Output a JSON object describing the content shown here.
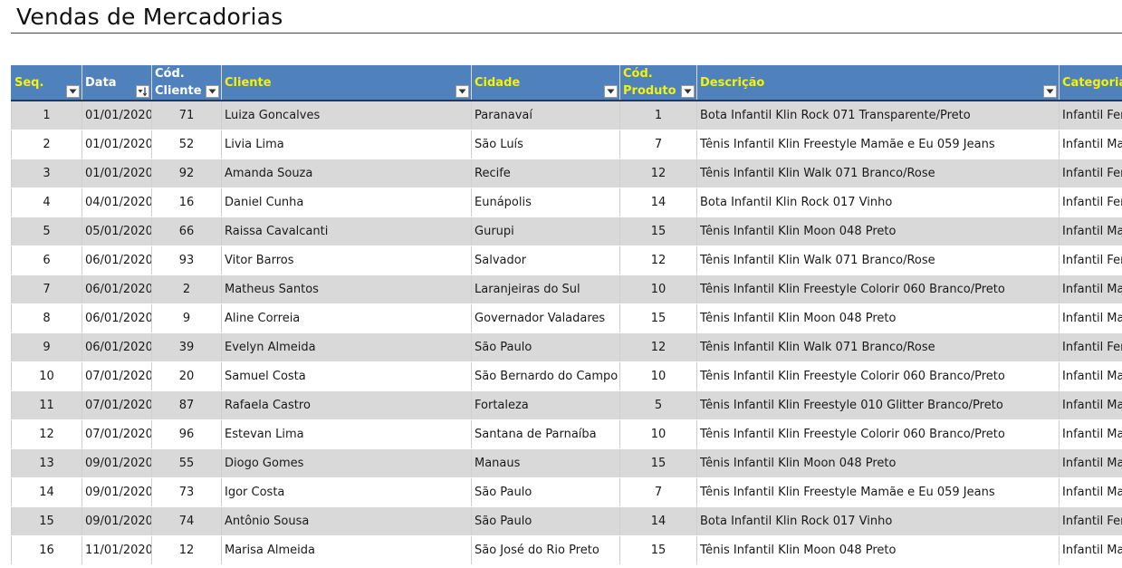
{
  "sheet": {
    "title": "Vendas de Mercadorias"
  },
  "table": {
    "columns": [
      {
        "key": "seq",
        "label": "Seq.",
        "yellow": true,
        "filter": "dropdown-icon"
      },
      {
        "key": "data",
        "label": "Data",
        "yellow": false,
        "filter": "sort-ascending-icon"
      },
      {
        "key": "cod_cliente",
        "label": "Cód. Cliente",
        "yellow": false,
        "filter": "dropdown-icon"
      },
      {
        "key": "cliente",
        "label": "Cliente",
        "yellow": true,
        "filter": "dropdown-icon"
      },
      {
        "key": "cidade",
        "label": "Cidade",
        "yellow": true,
        "filter": "dropdown-icon"
      },
      {
        "key": "cod_produto",
        "label": "Cód. Produto",
        "yellow": true,
        "filter": "dropdown-icon"
      },
      {
        "key": "descricao",
        "label": "Descrição",
        "yellow": true,
        "filter": "dropdown-icon"
      },
      {
        "key": "categoria",
        "label": "Categoria",
        "yellow": true,
        "filter": "dropdown-icon"
      }
    ],
    "rows": [
      [
        "1",
        "01/01/2020",
        "71",
        "Luiza Goncalves",
        "Paranavaí",
        "1",
        "Bota Infantil Klin Rock 071 Transparente/Preto",
        "Infantil Fer"
      ],
      [
        "2",
        "01/01/2020",
        "52",
        "Livia Lima",
        "São Luís",
        "7",
        "Tênis Infantil Klin Freestyle Mamãe e Eu 059 Jeans",
        "Infantil Ma"
      ],
      [
        "3",
        "01/01/2020",
        "92",
        "Amanda Souza",
        "Recife",
        "12",
        "Tênis Infantil Klin Walk 071 Branco/Rose",
        "Infantil Fer"
      ],
      [
        "4",
        "04/01/2020",
        "16",
        "Daniel Cunha",
        "Eunápolis",
        "14",
        "Bota Infantil Klin Rock 017 Vinho",
        "Infantil Fer"
      ],
      [
        "5",
        "05/01/2020",
        "66",
        "Raissa Cavalcanti",
        "Gurupi",
        "15",
        "Tênis Infantil Klin Moon 048 Preto",
        "Infantil Ma"
      ],
      [
        "6",
        "06/01/2020",
        "93",
        "Vitor Barros",
        "Salvador",
        "12",
        "Tênis Infantil Klin Walk 071 Branco/Rose",
        "Infantil Fer"
      ],
      [
        "7",
        "06/01/2020",
        "2",
        "Matheus Santos",
        "Laranjeiras do Sul",
        "10",
        "Tênis Infantil Klin Freestyle Colorir 060 Branco/Preto",
        "Infantil Ma"
      ],
      [
        "8",
        "06/01/2020",
        "9",
        "Aline Correia",
        "Governador Valadares",
        "15",
        "Tênis Infantil Klin Moon 048 Preto",
        "Infantil Ma"
      ],
      [
        "9",
        "06/01/2020",
        "39",
        "Evelyn Almeida",
        "São Paulo",
        "12",
        "Tênis Infantil Klin Walk 071 Branco/Rose",
        "Infantil Fer"
      ],
      [
        "10",
        "07/01/2020",
        "20",
        "Samuel Costa",
        "São Bernardo do Campo",
        "10",
        "Tênis Infantil Klin Freestyle Colorir 060 Branco/Preto",
        "Infantil Ma"
      ],
      [
        "11",
        "07/01/2020",
        "87",
        "Rafaela Castro",
        "Fortaleza",
        "5",
        "Tênis Infantil Klin Freestyle 010 Glitter Branco/Preto",
        "Infantil Ma"
      ],
      [
        "12",
        "07/01/2020",
        "96",
        "Estevan Lima",
        "Santana de Parnaíba",
        "10",
        "Tênis Infantil Klin Freestyle Colorir 060 Branco/Preto",
        "Infantil Ma"
      ],
      [
        "13",
        "09/01/2020",
        "55",
        "Diogo Gomes",
        "Manaus",
        "15",
        "Tênis Infantil Klin Moon 048 Preto",
        "Infantil Ma"
      ],
      [
        "14",
        "09/01/2020",
        "73",
        "Igor Costa",
        "São Paulo",
        "7",
        "Tênis Infantil Klin Freestyle Mamãe e Eu 059 Jeans",
        "Infantil Ma"
      ],
      [
        "15",
        "09/01/2020",
        "74",
        "Antônio Sousa",
        "São Paulo",
        "14",
        "Bota Infantil Klin Rock 017 Vinho",
        "Infantil Fer"
      ],
      [
        "16",
        "11/01/2020",
        "12",
        "Marisa Almeida",
        "São José do Rio Preto",
        "15",
        "Tênis Infantil Klin Moon 048 Preto",
        "Infantil Ma"
      ]
    ]
  },
  "colors": {
    "header_bg": "#4f81bd",
    "header_text_yellow": "#f2f20c",
    "header_text_white": "#ffffff",
    "band_row": "#d9d9d9"
  }
}
